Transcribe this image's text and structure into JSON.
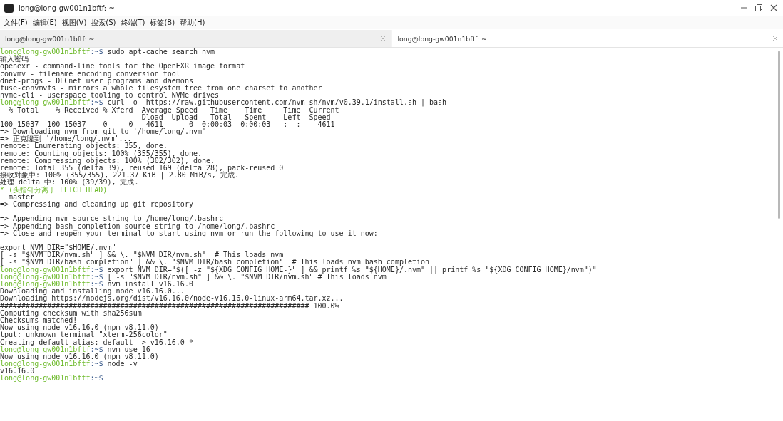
{
  "window": {
    "title": "long@long-gw001n1bftf: ~"
  },
  "menu": [
    "文件(F)",
    "编辑(E)",
    "视图(V)",
    "搜索(S)",
    "终端(T)",
    "标签(B)",
    "帮助(H)"
  ],
  "tabs": [
    {
      "label": "long@long-gw001n1bftf: ~",
      "selected": false
    },
    {
      "label": "long@long-gw001n1bftf: ~",
      "selected": true
    }
  ],
  "terminal": {
    "lines": [
      {
        "kind": "prompt",
        "user": "long@long-gw001n1bftf",
        "path": ":~$",
        "command": " sudo apt-cache search nvm"
      },
      {
        "kind": "output",
        "text": "输入密码"
      },
      {
        "kind": "output",
        "text": "openexr - command-line tools for the OpenEXR image format"
      },
      {
        "kind": "output",
        "text": "convmv - filename encoding conversion tool"
      },
      {
        "kind": "output",
        "text": "dnet-progs - DECnet user programs and daemons"
      },
      {
        "kind": "output",
        "text": "fuse-convmvfs - mirrors a whole filesystem tree from one charset to another"
      },
      {
        "kind": "output",
        "text": "nvme-cli - userspace tooling to control NVMe drives"
      },
      {
        "kind": "prompt",
        "user": "long@long-gw001n1bftf",
        "path": ":~$",
        "command": " curl -o- https://raw.githubusercontent.com/nvm-sh/nvm/v0.39.1/install.sh | bash"
      },
      {
        "kind": "output",
        "text": "  % Total    % Received % Xferd  Average Speed   Time    Time     Time  Current"
      },
      {
        "kind": "output",
        "text": "                                 Dload  Upload   Total   Spent    Left  Speed"
      },
      {
        "kind": "output",
        "text": "100 15037  100 15037    0     0   4611      0  0:00:03  0:00:03 --:--:--  4611"
      },
      {
        "kind": "output",
        "text": "=> Downloading nvm from git to '/home/long/.nvm'"
      },
      {
        "kind": "output",
        "text": "=> 正克隆到 '/home/long/.nvm'..."
      },
      {
        "kind": "output",
        "text": "remote: Enumerating objects: 355, done."
      },
      {
        "kind": "output",
        "text": "remote: Counting objects: 100% (355/355), done."
      },
      {
        "kind": "output",
        "text": "remote: Compressing objects: 100% (302/302), done."
      },
      {
        "kind": "output",
        "text": "remote: Total 355 (delta 39), reused 169 (delta 28), pack-reused 0"
      },
      {
        "kind": "output",
        "text": "接收对象中: 100% (355/355), 221.37 KiB | 2.80 MiB/s, 完成."
      },
      {
        "kind": "output",
        "text": "处理 delta 中: 100% (39/39), 完成."
      },
      {
        "kind": "highlight",
        "text": "* (头指针分离于 FETCH_HEAD)"
      },
      {
        "kind": "output",
        "text": "  master"
      },
      {
        "kind": "output",
        "text": "=> Compressing and cleaning up git repository"
      },
      {
        "kind": "blank"
      },
      {
        "kind": "output",
        "text": "=> Appending nvm source string to /home/long/.bashrc"
      },
      {
        "kind": "output",
        "text": "=> Appending bash_completion source string to /home/long/.bashrc"
      },
      {
        "kind": "output",
        "text": "=> Close and reopen your terminal to start using nvm or run the following to use it now:"
      },
      {
        "kind": "blank"
      },
      {
        "kind": "output",
        "text": "export NVM_DIR=\"$HOME/.nvm\""
      },
      {
        "kind": "output",
        "text": "[ -s \"$NVM_DIR/nvm.sh\" ] && \\. \"$NVM_DIR/nvm.sh\"  # This loads nvm"
      },
      {
        "kind": "output",
        "text": "[ -s \"$NVM_DIR/bash_completion\" ] && \\. \"$NVM_DIR/bash_completion\"  # This loads nvm bash_completion"
      },
      {
        "kind": "prompt",
        "user": "long@long-gw001n1bftf",
        "path": ":~$",
        "command": " export NVM_DIR=\"$([ -z \"${XDG_CONFIG_HOME-}\" ] && printf %s \"${HOME}/.nvm\" || printf %s \"${XDG_CONFIG_HOME}/nvm\")\""
      },
      {
        "kind": "prompt",
        "user": "long@long-gw001n1bftf",
        "path": ":~$",
        "command": " [ -s \"$NVM_DIR/nvm.sh\" ] && \\. \"$NVM_DIR/nvm.sh\" # This loads nvm"
      },
      {
        "kind": "prompt",
        "user": "long@long-gw001n1bftf",
        "path": ":~$",
        "command": " nvm install v16.16.0"
      },
      {
        "kind": "output",
        "text": "Downloading and installing node v16.16.0..."
      },
      {
        "kind": "output",
        "text": "Downloading https://nodejs.org/dist/v16.16.0/node-v16.16.0-linux-arm64.tar.xz..."
      },
      {
        "kind": "output",
        "text": "######################################################################## 100.0%"
      },
      {
        "kind": "output",
        "text": "Computing checksum with sha256sum"
      },
      {
        "kind": "output",
        "text": "Checksums matched!"
      },
      {
        "kind": "output",
        "text": "Now using node v16.16.0 (npm v8.11.0)"
      },
      {
        "kind": "output",
        "text": "tput: unknown terminal \"xterm-256color\""
      },
      {
        "kind": "output",
        "text": "Creating default alias: default -> v16.16.0 *"
      },
      {
        "kind": "prompt",
        "user": "long@long-gw001n1bftf",
        "path": ":~$",
        "command": " nvm use 16"
      },
      {
        "kind": "output",
        "text": "Now using node v16.16.0 (npm v8.11.0)"
      },
      {
        "kind": "prompt",
        "user": "long@long-gw001n1bftf",
        "path": ":~$",
        "command": " node -v"
      },
      {
        "kind": "output",
        "text": "v16.16.0"
      },
      {
        "kind": "prompt",
        "user": "long@long-gw001n1bftf",
        "path": ":~$"
      }
    ]
  }
}
